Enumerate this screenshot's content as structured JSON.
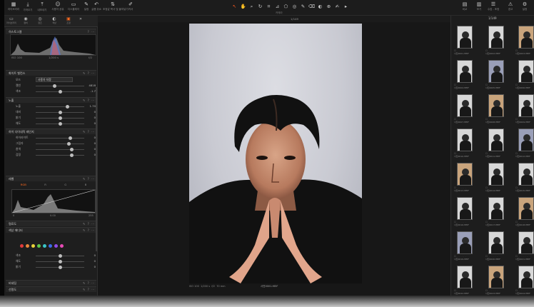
{
  "toolbar": {
    "left_buttons": [
      {
        "icon": "grid-icon",
        "label": "라이브러리"
      },
      {
        "icon": "import-icon",
        "label": "가져오기"
      },
      {
        "icon": "export-icon",
        "label": "내보내기"
      },
      {
        "icon": "people-icon",
        "label": "사용자 공유"
      },
      {
        "icon": "display-icon",
        "label": "디스플레이"
      },
      {
        "icon": "pin-icon",
        "label": "설정"
      },
      {
        "icon": "undo-icon",
        "label": "실행 취소"
      },
      {
        "icon": "copy-icon",
        "label": "조정값 복사 및 붙여넣기"
      },
      {
        "icon": "brush-icon",
        "label": "커서"
      }
    ],
    "right_buttons": [
      {
        "icon": "layout-icon",
        "label": "비교"
      },
      {
        "icon": "grid-view-icon",
        "label": "보기"
      },
      {
        "icon": "sliders-icon",
        "label": "수업 ‐ 조정"
      },
      {
        "icon": "warning-icon",
        "label": "경고"
      },
      {
        "icon": "settings-icon",
        "label": "설정"
      }
    ],
    "title": "카메라"
  },
  "left_panel": {
    "tabs": [
      "라이브러리",
      "캡처",
      "렌즈",
      "색상",
      "조정"
    ],
    "histogram_title": "히스토그램",
    "histogram_readout": [
      "ISO 100",
      "1/200 s",
      "f/2"
    ],
    "sections": {
      "white_balance": "화이트 밸런스",
      "wb_mode_label": "모드",
      "wb_mode_value": "사용자 지정",
      "wb_rows": [
        {
          "name": "켈빈",
          "value": "4818"
        },
        {
          "name": "색조",
          "value": "-1.7"
        }
      ],
      "exposure": "노출",
      "exposure_rows": [
        {
          "name": "노출",
          "value": "1.70"
        },
        {
          "name": "대비",
          "value": "0"
        },
        {
          "name": "밝기",
          "value": "0"
        },
        {
          "name": "채도",
          "value": "0"
        }
      ],
      "hdr": "하이 다이내믹 레인지",
      "hdr_rows": [
        {
          "name": "하이라이트",
          "value": "0"
        },
        {
          "name": "그림자",
          "value": "0"
        },
        {
          "name": "흰색",
          "value": "0"
        },
        {
          "name": "검정",
          "value": "0"
        }
      ],
      "levels": "레벨",
      "curve_tabs": [
        "RGB",
        "R",
        "G",
        "B"
      ],
      "curve_readout": [
        "0",
        "0.00",
        "255"
      ],
      "clarity": "명료도",
      "color_editor": "색상 에디터",
      "color_rows": [
        {
          "name": "색조",
          "value": "0"
        },
        {
          "name": "채도",
          "value": "0"
        },
        {
          "name": "밝기",
          "value": "0"
        }
      ],
      "vignette": "비네팅",
      "sharpen": "선명도",
      "bottom_button": "기본",
      "bottom_tab": "고급"
    },
    "swatch_colors": [
      "#e23b3b",
      "#e8873a",
      "#e8d23a",
      "#5dc84a",
      "#3ac4c8",
      "#3a6be8",
      "#8f4ae8",
      "#e84ab5"
    ]
  },
  "viewer": {
    "counter": "1/149",
    "meta": [
      "ISO 100",
      "1/200 s",
      "f/2",
      "70 mm"
    ],
    "filename": "사진0001.HEIF",
    "accent": "#ff5a1f"
  },
  "browser": {
    "counter": "1/149",
    "thumbnails": [
      "사진0001.HEIF",
      "사진0002.HEIF",
      "사진0003.HEIF",
      "사진0004.HEIF",
      "사진0005.HEIF",
      "사진0006.HEIF",
      "사진0007.HEIF",
      "사진0008.HEIF",
      "사진0009.HEIF",
      "사진0010.HEIF",
      "사진0011.HEIF",
      "사진0012.HEIF",
      "사진0013.HEIF",
      "사진0014.HEIF",
      "사진0015.HEIF",
      "사진0016.HEIF",
      "사진0017.HEIF",
      "사진0018.HEIF",
      "사진0019.HEIF",
      "사진0020.HEIF",
      "사진0021.HEIF",
      "사진0022.HEIF",
      "사진0023.HEIF",
      "사진0024.HEIF"
    ]
  }
}
